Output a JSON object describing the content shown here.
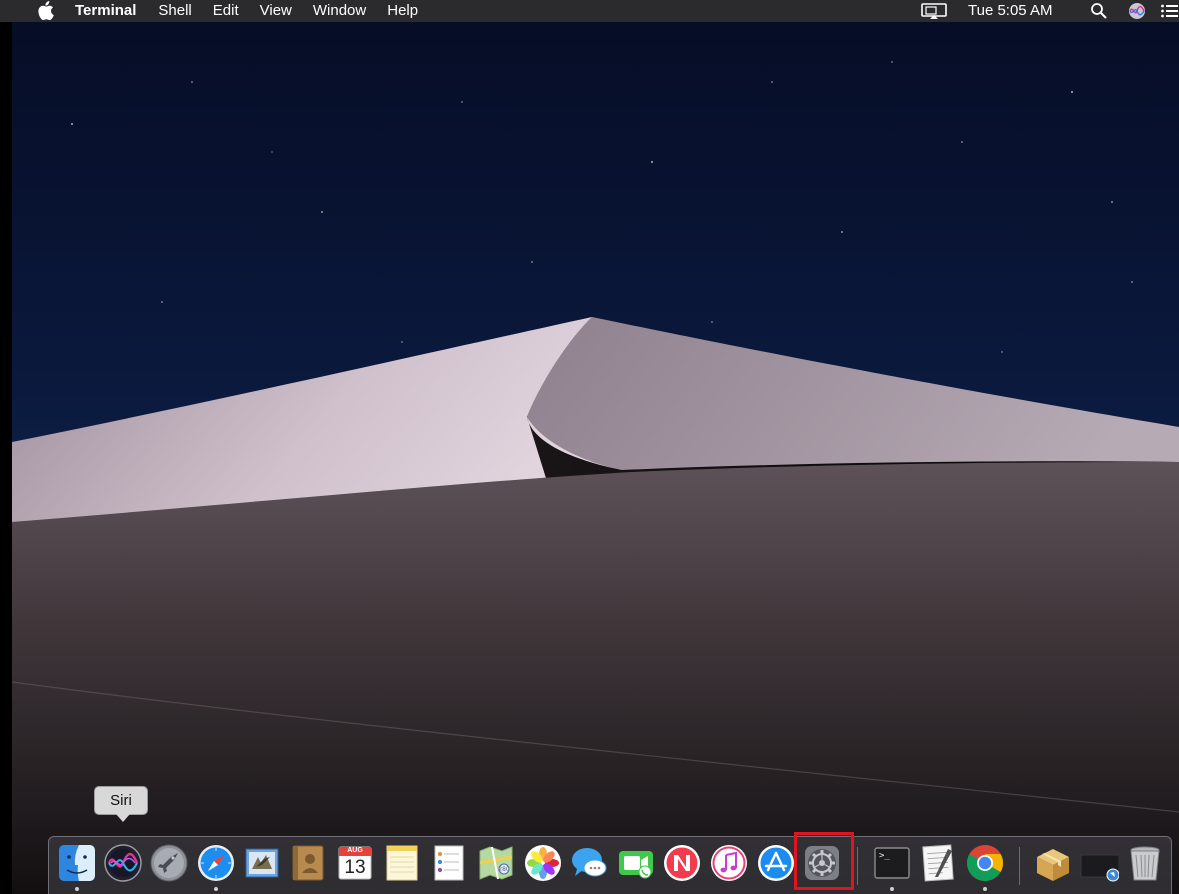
{
  "menubar": {
    "apple_icon": "apple-logo-icon",
    "app_name": "Terminal",
    "menus": [
      "Shell",
      "Edit",
      "View",
      "Window",
      "Help"
    ],
    "clock": "Tue 5:05 AM",
    "icons": [
      "airplay-display-icon",
      "spotlight-search-icon",
      "siri-icon",
      "notification-center-icon"
    ]
  },
  "tooltip": {
    "text": "Siri"
  },
  "dock": {
    "apps": [
      {
        "name": "Finder",
        "icon": "finder-icon",
        "running": true
      },
      {
        "name": "Siri",
        "icon": "siri-icon",
        "running": false
      },
      {
        "name": "Launchpad",
        "icon": "launchpad-icon",
        "running": false
      },
      {
        "name": "Safari",
        "icon": "safari-icon",
        "running": true
      },
      {
        "name": "Mail",
        "icon": "mail-icon",
        "running": false
      },
      {
        "name": "Contacts",
        "icon": "contacts-icon",
        "running": false
      },
      {
        "name": "Calendar",
        "icon": "calendar-icon",
        "running": false
      },
      {
        "name": "Notes",
        "icon": "notes-icon",
        "running": false
      },
      {
        "name": "Reminders",
        "icon": "reminders-icon",
        "running": false
      },
      {
        "name": "Maps",
        "icon": "maps-icon",
        "running": false
      },
      {
        "name": "Photos",
        "icon": "photos-icon",
        "running": false
      },
      {
        "name": "Messages",
        "icon": "messages-icon",
        "running": false
      },
      {
        "name": "FaceTime",
        "icon": "facetime-icon",
        "running": false
      },
      {
        "name": "News",
        "icon": "news-icon",
        "running": false
      },
      {
        "name": "iTunes",
        "icon": "itunes-icon",
        "running": false
      },
      {
        "name": "App Store",
        "icon": "app-store-icon",
        "running": false
      },
      {
        "name": "System Preferences",
        "icon": "system-preferences-icon",
        "running": false,
        "highlighted": true
      },
      {
        "name": "Terminal",
        "icon": "terminal-icon",
        "running": true
      },
      {
        "name": "TextEdit",
        "icon": "textedit-icon",
        "running": false
      },
      {
        "name": "Google Chrome",
        "icon": "chrome-icon",
        "running": true
      },
      {
        "name": "Installer Package",
        "icon": "package-icon",
        "running": false
      },
      {
        "name": "Downloads Stack",
        "icon": "downloads-stack-icon",
        "running": false
      },
      {
        "name": "Trash",
        "icon": "trash-icon",
        "running": false
      }
    ],
    "calendar": {
      "month": "AUG",
      "day": "13"
    },
    "terminal_prompt": ">_"
  },
  "colors": {
    "menubar": "#2b2b2d",
    "highlight": "#e0141e",
    "sky": "#0b1a3f"
  }
}
